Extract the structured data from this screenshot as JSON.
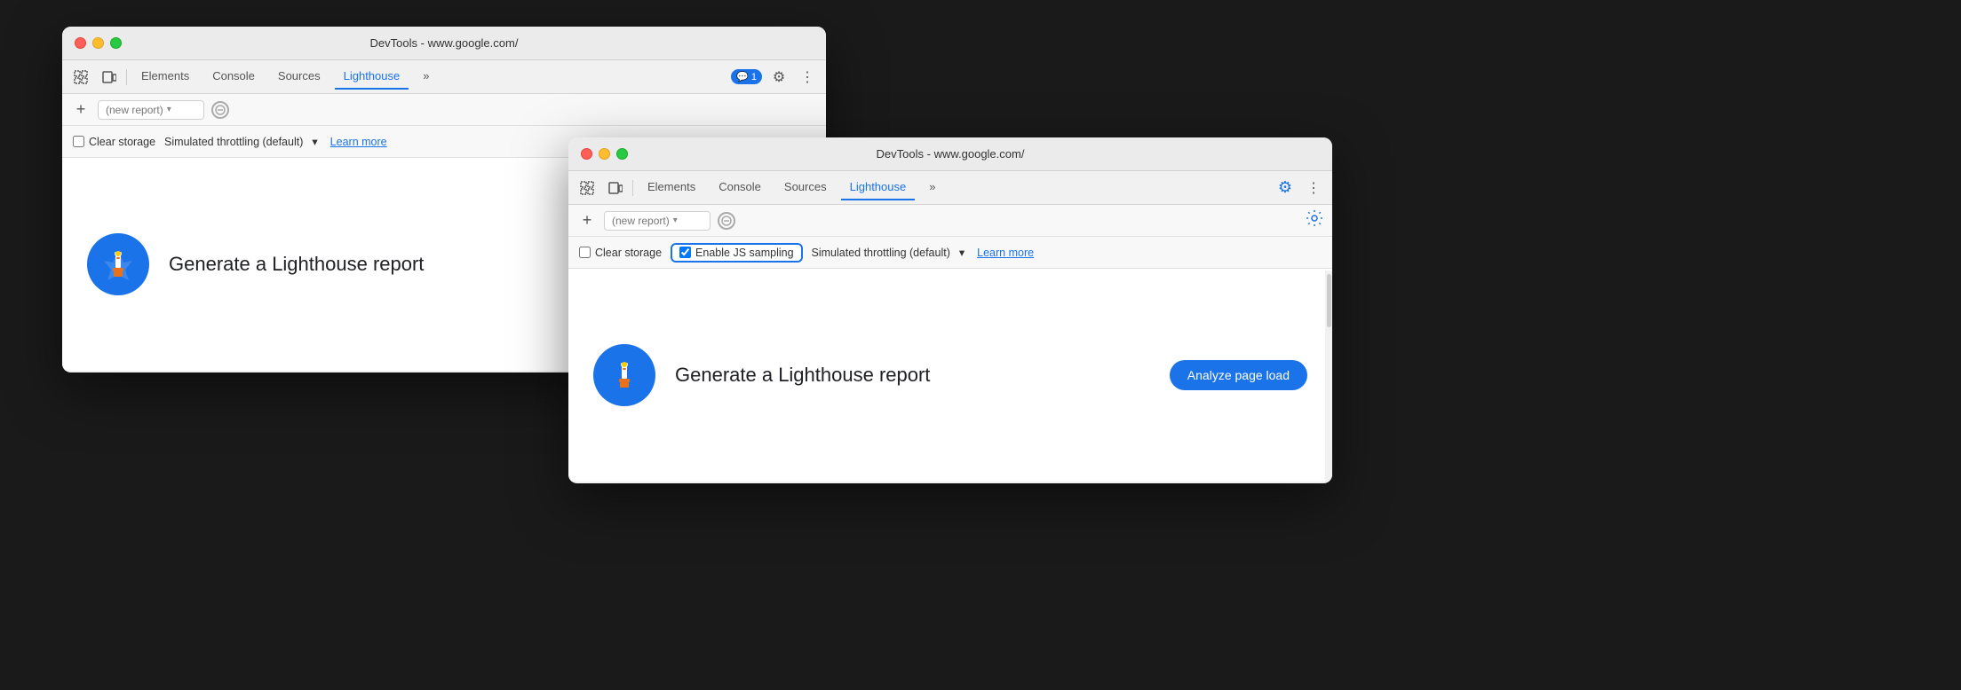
{
  "window_back": {
    "title": "DevTools - www.google.com/",
    "tabs": [
      {
        "label": "Elements",
        "active": false
      },
      {
        "label": "Console",
        "active": false
      },
      {
        "label": "Sources",
        "active": false
      },
      {
        "label": "Lighthouse",
        "active": true
      }
    ],
    "chevron": "»",
    "badge_count": "1",
    "report_placeholder": "(new report)",
    "options": {
      "clear_storage": "Clear storage",
      "throttling": "Simulated throttling (default)",
      "learn_more": "Learn more"
    },
    "main": {
      "generate_text": "Generate a Lighthouse report"
    }
  },
  "window_front": {
    "title": "DevTools - www.google.com/",
    "tabs": [
      {
        "label": "Elements",
        "active": false
      },
      {
        "label": "Console",
        "active": false
      },
      {
        "label": "Sources",
        "active": false
      },
      {
        "label": "Lighthouse",
        "active": true
      }
    ],
    "chevron": "»",
    "report_placeholder": "(new report)",
    "options": {
      "clear_storage": "Clear storage",
      "enable_js_sampling": "Enable JS sampling",
      "throttling": "Simulated throttling (default)",
      "learn_more": "Learn more"
    },
    "main": {
      "generate_text": "Generate a Lighthouse report",
      "analyze_btn": "Analyze page load"
    }
  },
  "icons": {
    "cursor": "⬚",
    "device": "⬜",
    "plus": "+",
    "cancel": "⊘",
    "gear": "⚙",
    "more": "⋮",
    "chat": "💬",
    "chevron_down": "▾"
  }
}
